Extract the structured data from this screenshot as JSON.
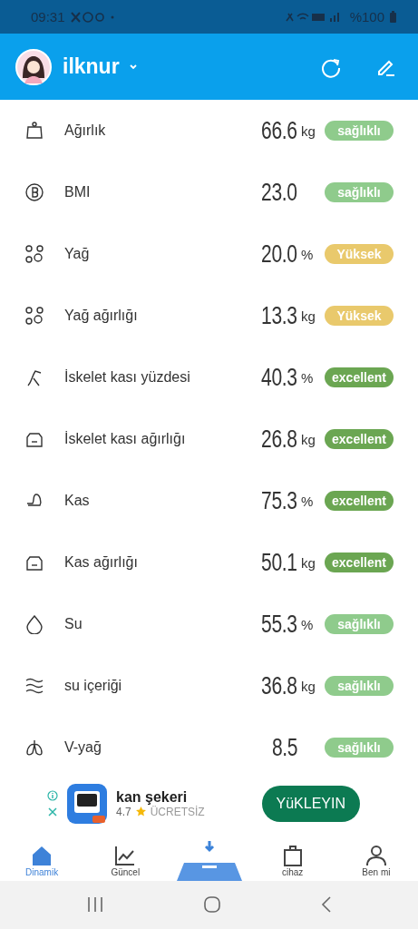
{
  "status_bar": {
    "time": "09:31",
    "battery": "%100"
  },
  "header": {
    "user": "ilknur"
  },
  "metrics": [
    {
      "name": "Ağırlık",
      "value": "66.6",
      "unit": "kg",
      "color": "#8fcb8c",
      "tag": "sağlıklı"
    },
    {
      "name": "BMI",
      "value": "23.0",
      "color": "#8fcb8c",
      "tag": "sağlıklı"
    },
    {
      "name": "Yağ",
      "value": "20.0",
      "unit": "%",
      "color": "#e9c96c",
      "tag": "Yüksek"
    },
    {
      "name": "Yağ ağırlığı",
      "value": "13.3",
      "unit": "kg",
      "color": "#e9c96c",
      "tag": "Yüksek"
    },
    {
      "name": "İskelet kası yüzdesi",
      "value": "40.3",
      "unit": "%",
      "color": "#6ba652",
      "tag": "excellent"
    },
    {
      "name": "İskelet kası ağırlığı",
      "value": "26.8",
      "unit": "kg",
      "color": "#6ba652",
      "tag": "excellent"
    },
    {
      "name": "Kas",
      "value": "75.3",
      "unit": "%",
      "color": "#6ba652",
      "tag": "excellent"
    },
    {
      "name": "Kas ağırlığı",
      "value": "50.1",
      "unit": "kg",
      "color": "#6ba652",
      "tag": "excellent"
    },
    {
      "name": "Su",
      "value": "55.3",
      "unit": "%",
      "color": "#8fcb8c",
      "tag": "sağlıklı"
    },
    {
      "name": "su içeriği",
      "value": "36.8",
      "unit": "kg",
      "color": "#8fcb8c",
      "tag": "sağlıklı"
    },
    {
      "name": "V-yağ",
      "value": "8.5",
      "color": "#8fcb8c",
      "tag": "sağlıklı"
    }
  ],
  "ad": {
    "title": "kan şekeri",
    "rating": "4.7",
    "price": "ÜCRETSİZ",
    "button": "YüKLEYIN"
  },
  "tabs": [
    {
      "label": "Dinamik",
      "selected": true
    },
    {
      "label": "Güncel",
      "selected": false
    },
    {
      "kind": "scale",
      "selected": false
    },
    {
      "label": "cihaz",
      "selected": false
    },
    {
      "label": "Ben mi",
      "selected": false
    }
  ]
}
